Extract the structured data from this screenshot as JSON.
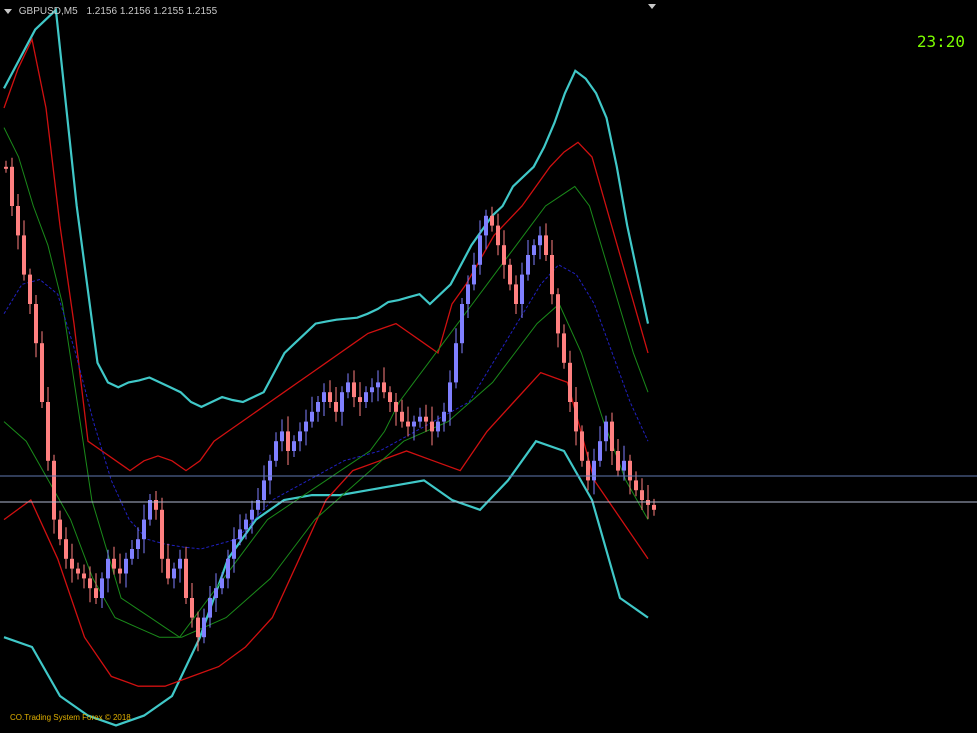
{
  "header": {
    "symbol": "GBPUSD,M5",
    "open": "1.2156",
    "high": "1.2156",
    "low": "1.2155",
    "close": "1.2155"
  },
  "clock": "23:20",
  "copyright": "CO.Trading System Forex  ©  2018",
  "colors": {
    "background": "#000000",
    "bull_candle": "#8080ff",
    "bear_candle": "#ff8080",
    "outer_band": "#40c8c8",
    "middle_band": "#d01010",
    "inner_band": "#1a8a1a",
    "center_line": "#2020c0",
    "price_lines": "#b0b8d0",
    "clock": "#7cfc00",
    "copyright": "#e0b000"
  },
  "chart_data": {
    "type": "candlestick",
    "symbol": "GBPUSD",
    "timeframe": "M5",
    "x": [
      0,
      6,
      12,
      18,
      24,
      30,
      36,
      42,
      48,
      54,
      60,
      66,
      72,
      78,
      84,
      90,
      96,
      102,
      108,
      114,
      120,
      126,
      132,
      138,
      144,
      150,
      156,
      162,
      168,
      174,
      180,
      186,
      192,
      198,
      204,
      210,
      216,
      222,
      228,
      234,
      240,
      246,
      252,
      258,
      264,
      270,
      276,
      282,
      288,
      294,
      300,
      306,
      312,
      318,
      324,
      330,
      336,
      342,
      348,
      354,
      360,
      366,
      372,
      378,
      384,
      390,
      396,
      402,
      408,
      414,
      420,
      426,
      432,
      438,
      444,
      450,
      456,
      462,
      468,
      474,
      480,
      486,
      492,
      498,
      504,
      510,
      516,
      522,
      528,
      534,
      540,
      546,
      552,
      558,
      564,
      570,
      576,
      582,
      588,
      594,
      600,
      606,
      612,
      618,
      624,
      630,
      636,
      642,
      648
    ],
    "close": [
      160,
      200,
      230,
      270,
      300,
      340,
      400,
      460,
      520,
      540,
      560,
      570,
      575,
      580,
      590,
      600,
      580,
      560,
      570,
      575,
      560,
      550,
      540,
      520,
      500,
      510,
      560,
      580,
      570,
      560,
      600,
      620,
      640,
      620,
      600,
      590,
      580,
      560,
      540,
      530,
      520,
      510,
      500,
      480,
      460,
      440,
      430,
      450,
      440,
      430,
      420,
      410,
      400,
      390,
      400,
      410,
      390,
      380,
      395,
      400,
      390,
      385,
      380,
      390,
      400,
      410,
      420,
      425,
      420,
      415,
      420,
      430,
      420,
      410,
      380,
      340,
      300,
      280,
      260,
      230,
      210,
      220,
      240,
      260,
      280,
      300,
      270,
      250,
      240,
      230,
      250,
      290,
      330,
      360,
      400,
      430,
      460,
      480,
      460,
      440,
      420,
      450,
      470,
      460,
      480,
      490,
      500,
      505,
      510
    ],
    "upper_outer": [
      80,
      60,
      40,
      20,
      10,
      0,
      100,
      200,
      280,
      360,
      380,
      385,
      380,
      378,
      375,
      380,
      385,
      390,
      400,
      405,
      400,
      395,
      398,
      400,
      395,
      390,
      370,
      350,
      340,
      330,
      320,
      318,
      316,
      315,
      314,
      310,
      305,
      298,
      296,
      293,
      290,
      300,
      290,
      280,
      260,
      240,
      225,
      210,
      200,
      180,
      170,
      160,
      140,
      115,
      85,
      62,
      70,
      85,
      110,
      160,
      220,
      270,
      320
    ],
    "upper_mid": [
      100,
      60,
      30,
      100,
      220,
      320,
      440,
      450,
      460,
      470,
      460,
      455,
      460,
      470,
      460,
      440,
      430,
      420,
      410,
      400,
      390,
      380,
      370,
      360,
      350,
      340,
      330,
      325,
      320,
      330,
      340,
      350,
      300,
      280,
      255,
      230,
      215,
      200,
      180,
      160,
      145,
      135,
      150,
      200,
      250,
      300,
      350
    ],
    "upper_inner": [
      120,
      150,
      200,
      240,
      300,
      400,
      500,
      550,
      600,
      610,
      620,
      630,
      640,
      620,
      600,
      580,
      560,
      540,
      520,
      510,
      500,
      490,
      480,
      470,
      460,
      450,
      430,
      400,
      380,
      360,
      340,
      320,
      300,
      280,
      260,
      240,
      220,
      200,
      190,
      180,
      200,
      250,
      300,
      350,
      390
    ],
    "center": [
      310,
      280,
      275,
      290,
      350,
      420,
      480,
      520,
      540,
      545,
      548,
      550,
      545,
      540,
      520,
      500,
      490,
      480,
      470,
      460,
      455,
      450,
      440,
      430,
      420,
      410,
      400,
      370,
      340,
      310,
      280,
      260,
      270,
      300,
      350,
      400,
      440
    ],
    "lower_inner": [
      420,
      440,
      480,
      520,
      580,
      620,
      630,
      640,
      640,
      630,
      620,
      600,
      580,
      550,
      520,
      500,
      480,
      460,
      440,
      430,
      420,
      400,
      380,
      350,
      320,
      300,
      350,
      420,
      480,
      520
    ],
    "lower_mid": [
      520,
      500,
      560,
      640,
      680,
      690,
      690,
      680,
      670,
      650,
      620,
      560,
      500,
      470,
      460,
      450,
      460,
      470,
      430,
      400,
      370,
      380,
      480,
      520,
      560
    ],
    "lower_outer": [
      640,
      650,
      700,
      720,
      730,
      720,
      700,
      640,
      560,
      520,
      500,
      495,
      495,
      490,
      485,
      480,
      500,
      510,
      480,
      440,
      450,
      500,
      600,
      620
    ],
    "current_price": "1.2155",
    "ylabel": "",
    "xlabel": ""
  }
}
